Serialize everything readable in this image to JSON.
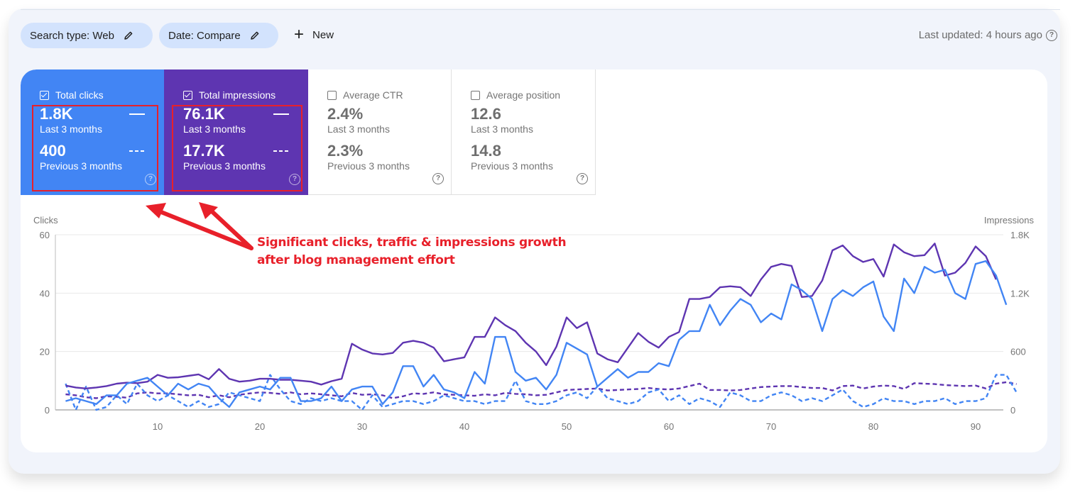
{
  "toolbar": {
    "chips": [
      {
        "label": "Search type: Web",
        "icon": "pencil-icon"
      },
      {
        "label": "Date: Compare",
        "icon": "pencil-icon"
      }
    ],
    "new_label": "New",
    "last_updated": "Last updated: 4 hours ago"
  },
  "metrics": [
    {
      "title": "Total clicks",
      "checked": true,
      "current": "1.8K",
      "current_label": "Last 3 months",
      "previous": "400",
      "previous_label": "Previous 3 months",
      "color": "#4285f4"
    },
    {
      "title": "Total impressions",
      "checked": true,
      "current": "76.1K",
      "current_label": "Last 3 months",
      "previous": "17.7K",
      "previous_label": "Previous 3 months",
      "color": "#5e35b1"
    },
    {
      "title": "Average CTR",
      "checked": false,
      "current": "2.4%",
      "current_label": "Last 3 months",
      "previous": "2.3%",
      "previous_label": "Previous 3 months"
    },
    {
      "title": "Average position",
      "checked": false,
      "current": "12.6",
      "current_label": "Last 3 months",
      "previous": "14.8",
      "previous_label": "Previous 3 months"
    }
  ],
  "annotation": {
    "line1": "Significant clicks, traffic & impressions growth",
    "line2": "after blog management effort",
    "color": "#e8202a"
  },
  "chart_data": {
    "type": "line",
    "xlabel": "",
    "ylabel_left": "Clicks",
    "ylabel_right": "Impressions",
    "x_ticks": [
      10,
      20,
      30,
      40,
      50,
      60,
      70,
      80,
      90
    ],
    "x_range": [
      1,
      92
    ],
    "ylim_left": [
      0,
      60
    ],
    "y_ticks_left": [
      "0",
      "20",
      "40",
      "60"
    ],
    "ylim_right": [
      0,
      1800
    ],
    "y_ticks_right": [
      "0",
      "600",
      "1.2K",
      "1.8K"
    ],
    "grid": true,
    "series": [
      {
        "name": "Clicks (Last 3 months)",
        "axis": "left",
        "style": "solid",
        "color": "#4285f4",
        "values": [
          3,
          4,
          3,
          2,
          5,
          5,
          9,
          10,
          11,
          8,
          5,
          9,
          7,
          9,
          8,
          4,
          1,
          6,
          7,
          8,
          7,
          11,
          11,
          3,
          3,
          4,
          8,
          3,
          7,
          8,
          8,
          2,
          6,
          15,
          15,
          8,
          12,
          7,
          6,
          4,
          13,
          9,
          25,
          25,
          13,
          10,
          11,
          7,
          12,
          23,
          21,
          19,
          8,
          11,
          14,
          11,
          13,
          13,
          16,
          15,
          24,
          27,
          27,
          36,
          29,
          34,
          38,
          36,
          30,
          33,
          31,
          43,
          41,
          38,
          27,
          38,
          41,
          39,
          42,
          44,
          32,
          27,
          45,
          40,
          49,
          47,
          48,
          40,
          38,
          50,
          51,
          46,
          36
        ]
      },
      {
        "name": "Impressions (Last 3 months)",
        "axis": "right",
        "style": "solid",
        "color": "#5e35b1",
        "values": [
          250,
          230,
          220,
          230,
          245,
          270,
          280,
          275,
          290,
          360,
          330,
          335,
          350,
          365,
          315,
          420,
          320,
          290,
          300,
          320,
          320,
          310,
          310,
          300,
          290,
          260,
          295,
          320,
          680,
          620,
          580,
          570,
          585,
          690,
          710,
          690,
          640,
          500,
          520,
          540,
          750,
          750,
          950,
          870,
          810,
          690,
          600,
          460,
          650,
          950,
          840,
          900,
          580,
          520,
          490,
          640,
          790,
          700,
          640,
          750,
          800,
          1140,
          1140,
          1160,
          1260,
          1270,
          1260,
          1170,
          1340,
          1470,
          1500,
          1480,
          1160,
          1170,
          1330,
          1640,
          1690,
          1580,
          1520,
          1550,
          1370,
          1700,
          1620,
          1580,
          1590,
          1710,
          1380,
          1410,
          1510,
          1680,
          1580,
          1340
        ]
      },
      {
        "name": "Clicks (Previous 3 months)",
        "axis": "left",
        "style": "dashed",
        "color": "#4285f4",
        "values": [
          9,
          0,
          8,
          0,
          1,
          5,
          2,
          9,
          5,
          3,
          5,
          3,
          1,
          3,
          1,
          2,
          6,
          5,
          4,
          3,
          12,
          7,
          3,
          2,
          4,
          3,
          4,
          3,
          3,
          0,
          5,
          1,
          2,
          3,
          3,
          2,
          3,
          5,
          4,
          3,
          3,
          2,
          3,
          3,
          10,
          3,
          2,
          2,
          3,
          5,
          6,
          4,
          8,
          4,
          3,
          2,
          3,
          6,
          7,
          3,
          5,
          2,
          4,
          3,
          1,
          6,
          5,
          3,
          3,
          5,
          6,
          5,
          3,
          4,
          3,
          5,
          7,
          3,
          1,
          2,
          4,
          3,
          3,
          2,
          3,
          3,
          4,
          2,
          3,
          3,
          4,
          12,
          12,
          6
        ]
      },
      {
        "name": "Impressions (Previous 3 months)",
        "axis": "right",
        "style": "dashed",
        "color": "#5e35b1",
        "values": [
          160,
          150,
          130,
          120,
          140,
          135,
          125,
          170,
          180,
          170,
          170,
          160,
          150,
          155,
          130,
          150,
          130,
          155,
          170,
          180,
          175,
          165,
          180,
          160,
          170,
          160,
          150,
          140,
          175,
          155,
          160,
          150,
          120,
          140,
          170,
          165,
          180,
          160,
          155,
          150,
          145,
          160,
          150,
          175,
          165,
          160,
          150,
          155,
          180,
          205,
          210,
          215,
          220,
          200,
          205,
          210,
          215,
          225,
          215,
          210,
          220,
          245,
          270,
          205,
          205,
          200,
          205,
          220,
          235,
          240,
          245,
          245,
          235,
          225,
          225,
          200,
          245,
          250,
          220,
          240,
          250,
          245,
          215,
          275,
          270,
          265,
          255,
          250,
          245,
          250,
          220,
          270,
          285,
          265
        ]
      }
    ]
  }
}
